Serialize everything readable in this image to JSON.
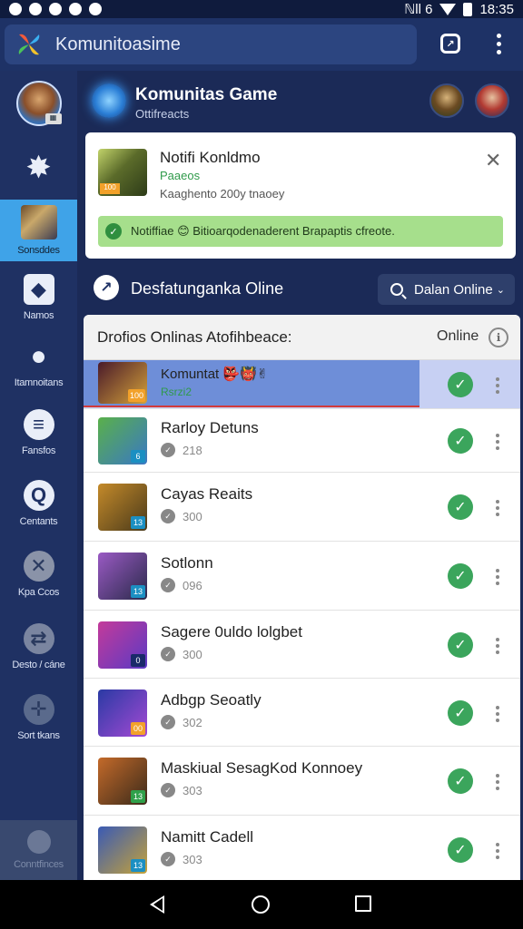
{
  "status_bar": {
    "time": "18:35",
    "signal": "ℕll 6"
  },
  "top_bar": {
    "title": "Komunitoasime"
  },
  "sidebar": {
    "items": [
      {
        "label": "Sonsddes"
      },
      {
        "label": "Namos"
      },
      {
        "label": "Itamnoitans"
      },
      {
        "label": "Fansfos"
      },
      {
        "label": "Centants"
      },
      {
        "label": "Kpa Ccos"
      },
      {
        "label": "Desto / cáne"
      },
      {
        "label": "Sort tkans"
      },
      {
        "label": "Conntfinces"
      }
    ]
  },
  "header": {
    "title": "Komunitas Game",
    "subtitle": "Ottifreacts"
  },
  "notification": {
    "title": "Notifi Konldmo",
    "highlight": "Paaeos",
    "description": "Kaaghento 200y tnaoey",
    "badge": "100",
    "banner": "Notiffiae 😊 Bitioarqodenaderent Brapaptis cfreote."
  },
  "section": {
    "title": "Desfatunganka Oline",
    "filter_label": "Dalan Online"
  },
  "list": {
    "heading": "Drofios Onlinas Atofihbeace:",
    "status_header": "Online",
    "rows": [
      {
        "title": "Komuntat 👺👹✌",
        "subtitle": "Rsrzi2",
        "badge": "100",
        "badge_color": "#f2a12a",
        "thumb_a": "#4a1a2a",
        "thumb_b": "#d4a23a"
      },
      {
        "title": "Rarloy Detuns",
        "subtitle": "218",
        "badge": "6",
        "badge_color": "#1b8fc2",
        "thumb_a": "#5ab04a",
        "thumb_b": "#3a78c4"
      },
      {
        "title": "Cayas Reaits",
        "subtitle": "300",
        "badge": "13",
        "badge_color": "#1b8fc2",
        "thumb_a": "#c48a2a",
        "thumb_b": "#4a3a1a"
      },
      {
        "title": "Sotlonn",
        "subtitle": "096",
        "badge": "13",
        "badge_color": "#1b8fc2",
        "thumb_a": "#9a5ac4",
        "thumb_b": "#2a2a4a"
      },
      {
        "title": "Sagere 0uldo lolgbet",
        "subtitle": "300",
        "badge": "0",
        "badge_color": "#1a2a6a",
        "thumb_a": "#c43a9a",
        "thumb_b": "#5a3ac4"
      },
      {
        "title": "Adbgp Seoatly",
        "subtitle": "302",
        "badge": "00",
        "badge_color": "#f2a12a",
        "thumb_a": "#2a3aa4",
        "thumb_b": "#a44ad4"
      },
      {
        "title": "Maskiual SesagKod Konnoey",
        "subtitle": "303",
        "badge": "13",
        "badge_color": "#2fa04a",
        "thumb_a": "#c46a2a",
        "thumb_b": "#3a2a1a"
      },
      {
        "title": "Namitt Cadell",
        "subtitle": "303",
        "badge": "13",
        "badge_color": "#1b8fc2",
        "thumb_a": "#3a5ab4",
        "thumb_b": "#c4a23a"
      }
    ]
  }
}
